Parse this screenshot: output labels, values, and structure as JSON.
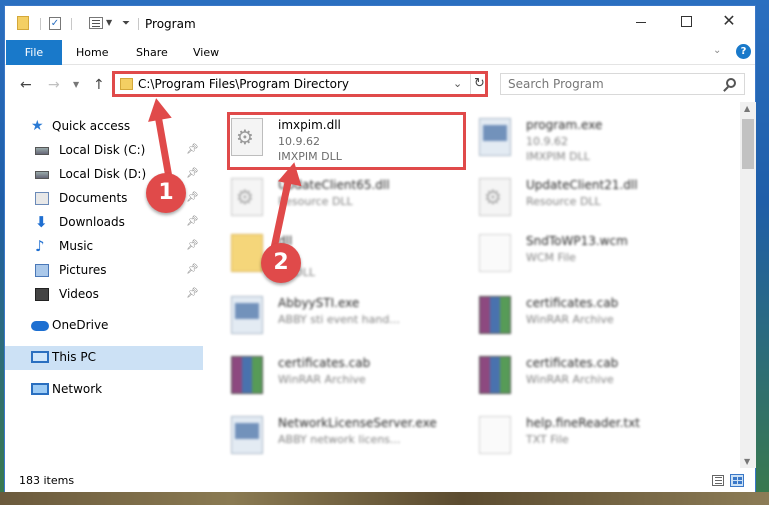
{
  "window": {
    "title": "Program",
    "ribbon_tabs": [
      "File",
      "Home",
      "Share",
      "View"
    ]
  },
  "nav": {
    "address": "C:\\Program Files\\Program Directory",
    "search_placeholder": "Search Program"
  },
  "sidebar": {
    "items": [
      {
        "label": "Quick access",
        "icon": "star-icon",
        "pinned": false
      },
      {
        "label": "Local Disk (C:)",
        "icon": "disk-icon",
        "pinned": true
      },
      {
        "label": "Local Disk (D:)",
        "icon": "disk-icon",
        "pinned": true
      },
      {
        "label": "Documents",
        "icon": "documents-icon",
        "pinned": true
      },
      {
        "label": "Downloads",
        "icon": "downloads-icon",
        "pinned": true
      },
      {
        "label": "Music",
        "icon": "music-icon",
        "pinned": true
      },
      {
        "label": "Pictures",
        "icon": "pictures-icon",
        "pinned": true
      },
      {
        "label": "Videos",
        "icon": "videos-icon",
        "pinned": true
      },
      {
        "label": "OneDrive",
        "icon": "onedrive-icon",
        "pinned": false
      },
      {
        "label": "This PC",
        "icon": "this-pc-icon",
        "pinned": false,
        "selected": true
      },
      {
        "label": "Network",
        "icon": "network-icon",
        "pinned": false
      }
    ]
  },
  "files": [
    {
      "name": "imxpim.dll",
      "line2": "10.9.62",
      "line3": "IMXPIM DLL",
      "icon": "dll-icon",
      "highlighted": true
    },
    {
      "name": "program.exe",
      "line2": "10.9.62",
      "line3": "IMXPIM DLL",
      "icon": "exe-icon"
    },
    {
      "name": "UpdateClient65.dll",
      "line2": "Resource DLL",
      "line3": "",
      "icon": "dll-icon"
    },
    {
      "name": "UpdateClient21.dll",
      "line2": "Resource DLL",
      "line3": "",
      "icon": "dll-icon"
    },
    {
      "name": "dll",
      "line2": "62",
      "line3": "IM DLL",
      "icon": "folder-icon"
    },
    {
      "name": "SndToWP13.wcm",
      "line2": "WCM File",
      "line3": "",
      "icon": "document-icon"
    },
    {
      "name": "AbbyySTI.exe",
      "line2": "ABBY sti event hand...",
      "line3": "",
      "icon": "exe-icon"
    },
    {
      "name": "certificates.cab",
      "line2": "WinRAR Archive",
      "line3": "",
      "icon": "winrar-icon"
    },
    {
      "name": "certificates.cab",
      "line2": "WinRAR Archive",
      "line3": "",
      "icon": "winrar-icon"
    },
    {
      "name": "certificates.cab",
      "line2": "WinRAR Archive",
      "line3": "",
      "icon": "winrar-icon"
    },
    {
      "name": "NetworkLicenseServer.exe",
      "line2": "ABBY network licens...",
      "line3": "",
      "icon": "exe-icon"
    },
    {
      "name": "help.fineReader.txt",
      "line2": "TXT File",
      "line3": "",
      "icon": "text-file-icon"
    }
  ],
  "status": {
    "item_count": "183 items"
  },
  "callouts": [
    "1",
    "2"
  ],
  "colors": {
    "accent": "#1979ca",
    "highlight": "#e04a4a",
    "selected_bg": "#cce1f5"
  }
}
